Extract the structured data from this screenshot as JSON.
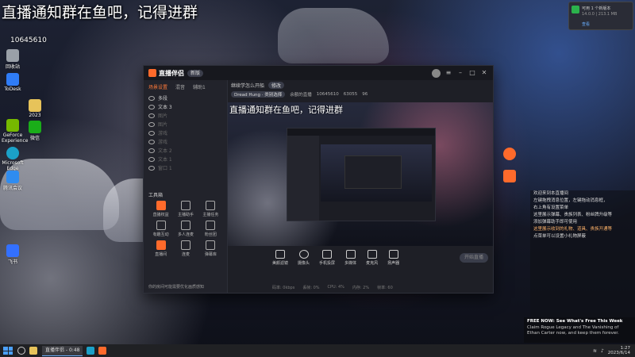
{
  "overlay": {
    "headline": "直播通知群在鱼吧，记得进群"
  },
  "desktop": {
    "user_id": "10645610",
    "icons": [
      {
        "label": "回收站",
        "icon": "recycle-bin-icon"
      },
      {
        "label": "ToDesk",
        "icon": "todesk-icon"
      },
      {
        "label": "GeForce Experience",
        "icon": "geforce-icon"
      },
      {
        "label": "Microsoft Edge",
        "icon": "edge-icon"
      },
      {
        "label": "腾讯会议",
        "icon": "meeting-icon"
      },
      {
        "label": "飞书",
        "icon": "feishu-icon"
      },
      {
        "label": "2023",
        "icon": "folder-icon"
      },
      {
        "label": "微信",
        "icon": "wechat-icon"
      }
    ]
  },
  "notification": {
    "title": "可用 1 个新版本",
    "body": "14.0.0 | 213.1 MB",
    "action": "查看"
  },
  "app": {
    "name": "直播伴侣",
    "version_pill": "新版",
    "stream_title": "继续学怎么开船",
    "title_edit": "修改",
    "category": "Dread Hung",
    "category_suffix": "类别选择",
    "info": [
      "余额的直播",
      "10645610",
      "63055",
      "96"
    ],
    "sidebar_tabs": [
      "场景设置",
      "混音",
      "辅助1"
    ],
    "scenes": [
      {
        "label": "多段",
        "dim": false
      },
      {
        "label": "文本 3",
        "dim": false
      },
      {
        "label": "图片",
        "dim": true
      },
      {
        "label": "图片",
        "dim": true
      },
      {
        "label": "游戏",
        "dim": true
      },
      {
        "label": "游戏",
        "dim": true
      },
      {
        "label": "文本 2",
        "dim": true
      },
      {
        "label": "文本 1",
        "dim": true
      },
      {
        "label": "窗口 1",
        "dim": true
      }
    ],
    "tools_header": "工具箱",
    "tools": [
      {
        "label": "直播权益",
        "orange": true
      },
      {
        "label": "主播助手",
        "orange": false
      },
      {
        "label": "主播任务",
        "orange": false
      },
      {
        "label": "有趣互动",
        "orange": false
      },
      {
        "label": "多人连麦",
        "orange": false
      },
      {
        "label": "粉丝团",
        "orange": false
      },
      {
        "label": "直播间",
        "orange": true
      },
      {
        "label": "连麦",
        "orange": false
      },
      {
        "label": "弹幕库",
        "orange": false
      }
    ],
    "sidebar_hint": "你的房间可能需要优化画质感知",
    "preview_text": "直播通知群在鱼吧，记得进群",
    "controls": [
      "美颜滤镜",
      "摄像头",
      "手机投屏",
      "多媒体",
      "麦克风",
      "扬声器"
    ],
    "start_button": "开始直播",
    "status": [
      "码率: 0kbps",
      "丢帧: 0%",
      "CPU: 4%",
      "内存: 2%",
      "帧率: 60"
    ]
  },
  "chat": {
    "lines": [
      {
        "text": "欢迎来到本直播间",
        "hl": false
      },
      {
        "text": "左键拖拽消息位置，左键拖动消息框，",
        "hl": false
      },
      {
        "text": "右上角有设置菜单",
        "hl": false
      },
      {
        "text": "这里展示弹幕、贵族列表、粉丝牌升级等",
        "hl": false
      },
      {
        "text": "添加弹幕助手即可使用",
        "hl": false
      },
      {
        "text": "这里展示收到的礼物、道具、贵族开通等",
        "hl": true
      },
      {
        "text": "点菜单可以设置小礼物屏蔽",
        "hl": false
      }
    ]
  },
  "promo": {
    "title": "FREE NOW: See What's Free This Week",
    "body": "Claim Rogue Legacy and The Vanishing of Ethan Carter now, and keep them forever."
  },
  "taskbar": {
    "active_app": "直播伴侣 - 0:48",
    "time": "1:27",
    "date": "2023/6/14"
  }
}
